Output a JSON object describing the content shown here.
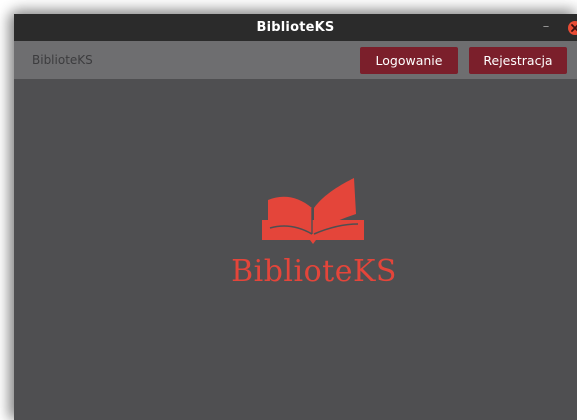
{
  "window": {
    "title": "BiblioteKS",
    "minimize_glyph": "–"
  },
  "menubar": {
    "app_name": "BiblioteKS",
    "login_label": "Logowanie",
    "register_label": "Rejestracja"
  },
  "logo": {
    "text": "BiblioteKS",
    "icon": "open-book-icon"
  },
  "colors": {
    "accent": "#e4453a",
    "button": "#7b1f2b",
    "titlebar": "#2b2b2b",
    "menubar": "#6e6e70",
    "background": "#4f4f51"
  }
}
